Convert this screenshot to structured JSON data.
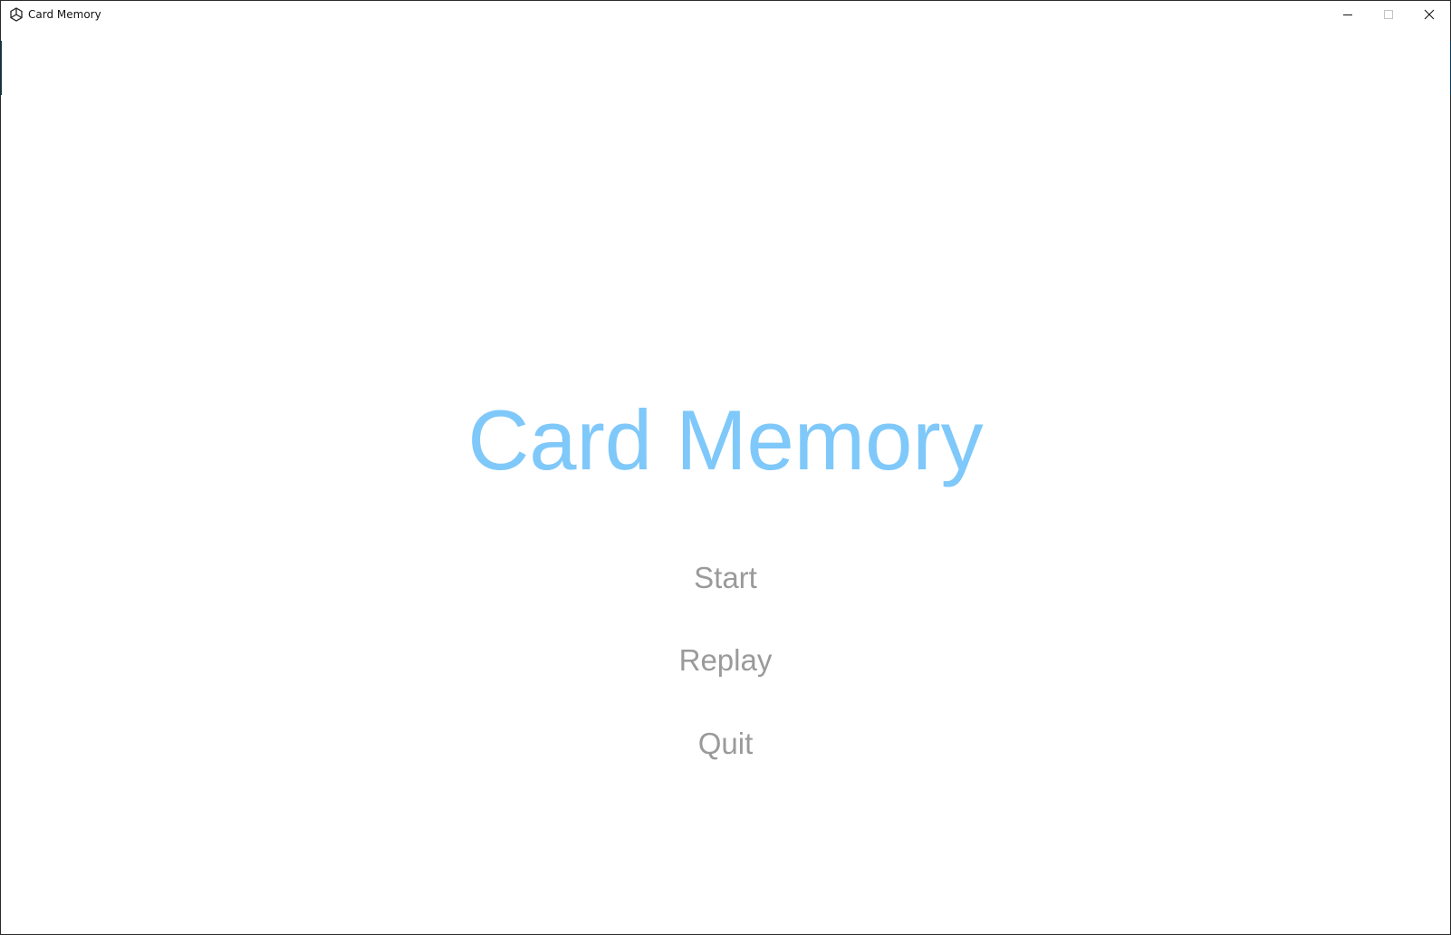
{
  "window": {
    "title": "Card Memory",
    "controls": {
      "minimize_icon": "minimize-icon",
      "maximize_icon": "maximize-icon",
      "close_icon": "close-icon"
    }
  },
  "main": {
    "title": "Card Memory",
    "menu": [
      {
        "label": "Start"
      },
      {
        "label": "Replay"
      },
      {
        "label": "Quit"
      }
    ]
  },
  "colors": {
    "title": "#7fc8fa",
    "menu_text": "#9a9a9a",
    "background": "#ffffff"
  }
}
